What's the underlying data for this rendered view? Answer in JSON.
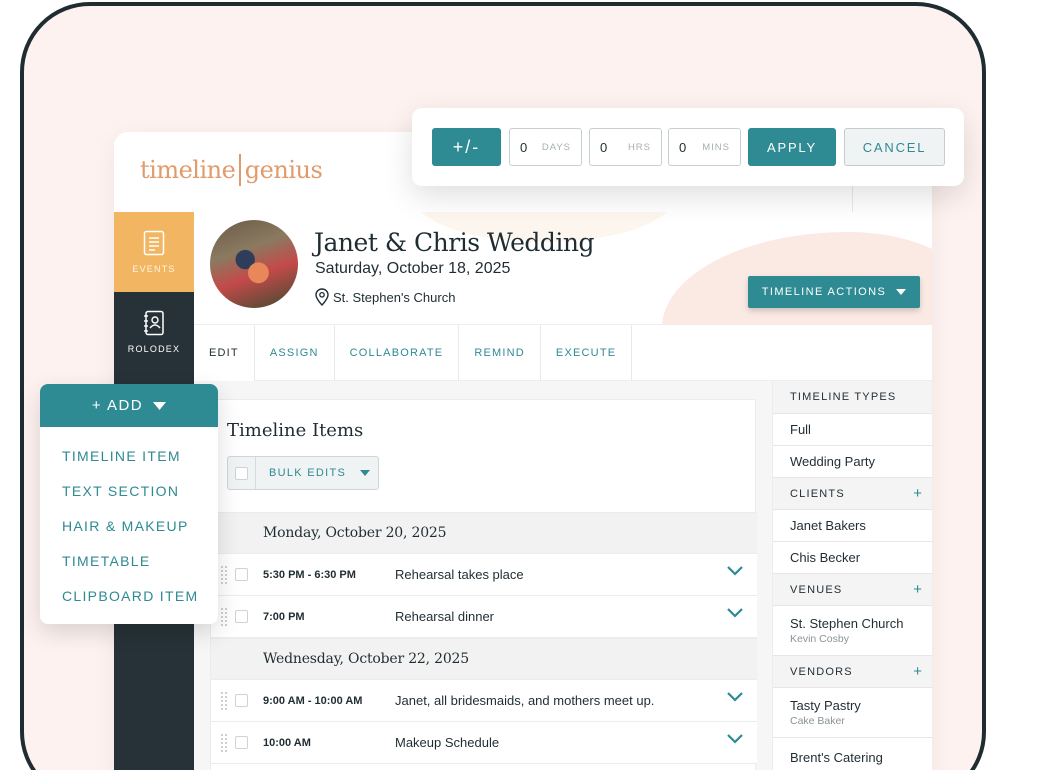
{
  "brand": {
    "logo_left": "timeline",
    "logo_right": "genius"
  },
  "sidebar": {
    "items": [
      {
        "label": "EVENTS",
        "icon": "document-icon",
        "active": true
      },
      {
        "label": "ROLODEX",
        "icon": "contact-book-icon",
        "active": false
      }
    ]
  },
  "event": {
    "title": "Janet & Chris Wedding",
    "date": "Saturday, October 18, 2025",
    "venue": "St. Stephen's Church",
    "actions_label": "TIMELINE ACTIONS"
  },
  "tabs": [
    "EDIT",
    "ASSIGN",
    "COLLABORATE",
    "REMIND",
    "EXECUTE"
  ],
  "timeline": {
    "title": "Timeline Items",
    "bulk_label": "BULK EDITS",
    "days": [
      {
        "heading": "Monday, October 20, 2025",
        "rows": [
          {
            "time": "5:30 PM - 6:30 PM",
            "desc": "Rehearsal takes place"
          },
          {
            "time": "7:00 PM",
            "desc": "Rehearsal dinner"
          }
        ]
      },
      {
        "heading": "Wednesday, October 22, 2025",
        "rows": [
          {
            "time": "9:00 AM - 10:00 AM",
            "desc": "Janet, all bridesmaids, and mothers meet up."
          },
          {
            "time": "10:00 AM",
            "desc": "Makeup Schedule"
          }
        ]
      }
    ]
  },
  "right_panel": {
    "timeline_types": {
      "heading": "TIMELINE TYPES",
      "items": [
        "Full",
        "Wedding Party"
      ]
    },
    "clients": {
      "heading": "CLIENTS",
      "plus": "+",
      "items": [
        "Janet Bakers",
        "Chis Becker"
      ]
    },
    "venues": {
      "heading": "VENUES",
      "plus": "+",
      "items": [
        {
          "name": "St. Stephen Church",
          "sub": "Kevin Cosby"
        }
      ]
    },
    "vendors": {
      "heading": "VENDORS",
      "plus": "+",
      "items": [
        {
          "name": "Tasty Pastry",
          "sub": "Cake Baker"
        },
        {
          "name": "Brent's Catering",
          "sub": ""
        }
      ]
    }
  },
  "time_shift": {
    "toggle_label": "+/-",
    "days": {
      "value": "0",
      "unit": "DAYS"
    },
    "hrs": {
      "value": "0",
      "unit": "HRS"
    },
    "mins": {
      "value": "0",
      "unit": "MINS"
    },
    "apply_label": "APPLY",
    "cancel_label": "CANCEL"
  },
  "add_menu": {
    "label": "+ ADD",
    "items": [
      "TIMELINE ITEM",
      "TEXT SECTION",
      "HAIR & MAKEUP",
      "TIMETABLE",
      "CLIPBOARD ITEM"
    ]
  },
  "colors": {
    "accent": "#2e8a93",
    "sidebar": "#263238",
    "active": "#f2b662",
    "logo": "#e29a6a",
    "background": "#fdf2ef"
  }
}
